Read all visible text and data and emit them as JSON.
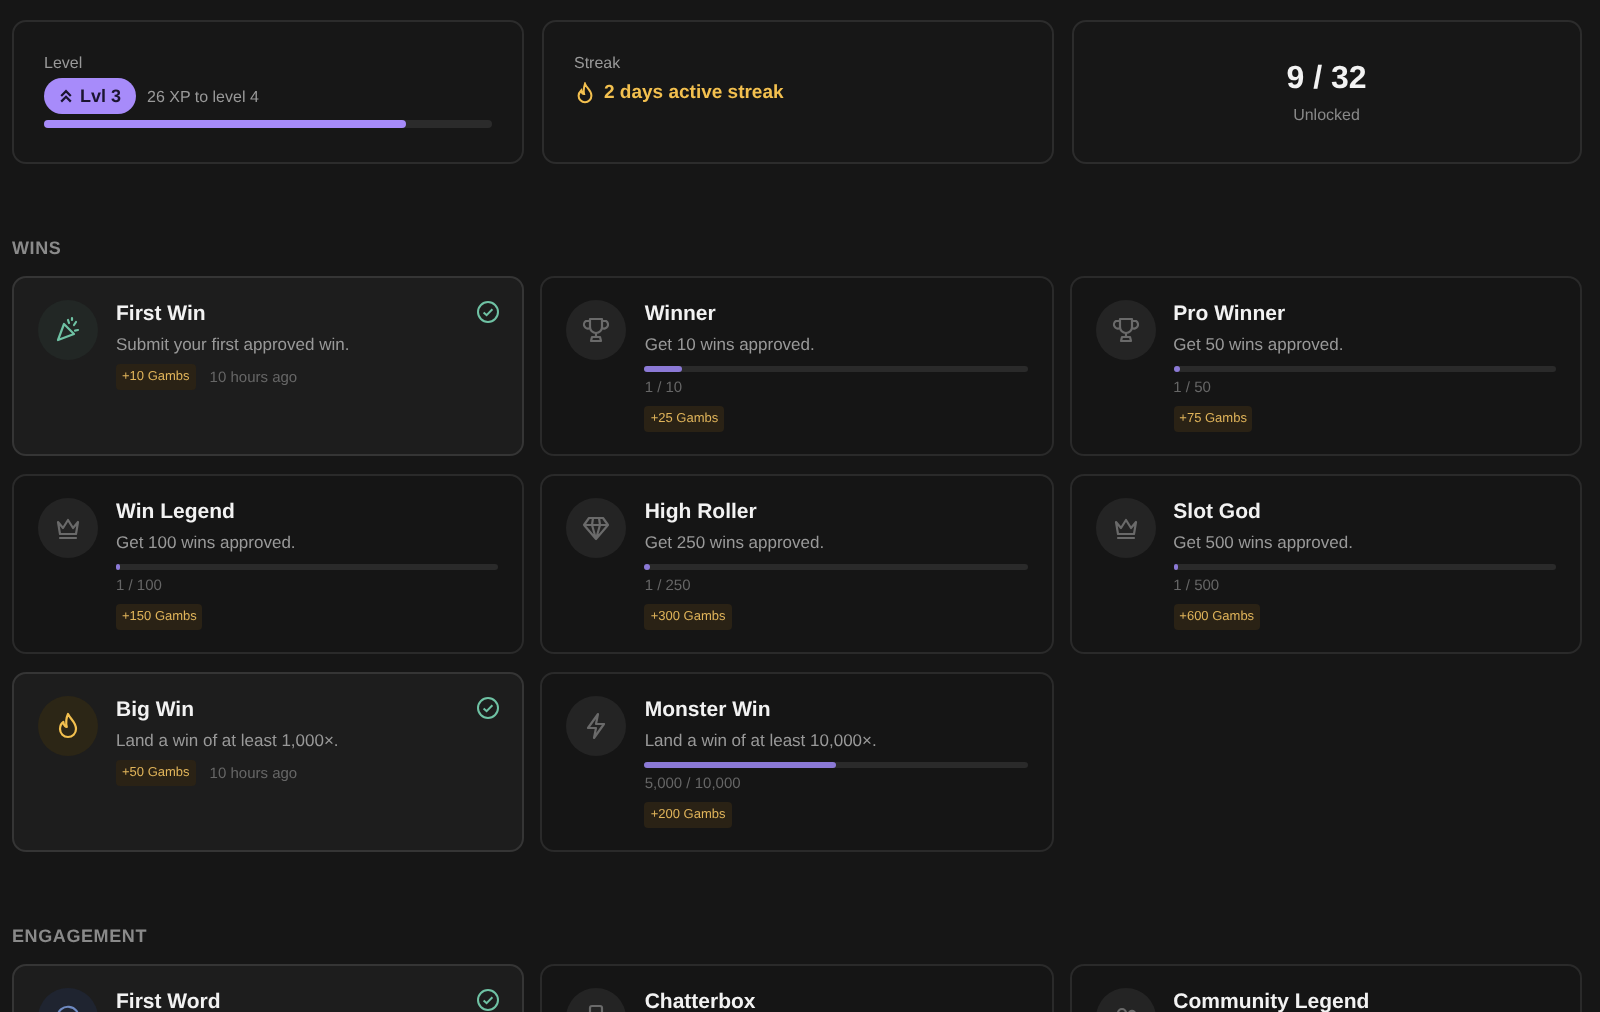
{
  "stats": {
    "level": {
      "label": "Level",
      "badge": "Lvl 3",
      "xp_text": "26 XP to level 4",
      "level": 0.81
    },
    "streak": {
      "label": "Streak",
      "text": "2 days active streak"
    },
    "unlocked": {
      "value": "9 / 32",
      "label": "Unlocked"
    }
  },
  "sections": [
    {
      "title": "WINS",
      "items": [
        {
          "title": "First Win",
          "description": "Submit your first approved win.",
          "reward": "+10 Gambs",
          "unlocked": true,
          "time": "10 hours ago"
        },
        {
          "title": "Winner",
          "description": "Get 10 wins approved.",
          "reward": "+25 Gambs",
          "unlocked": false,
          "level": 0.1,
          "progress": "1 / 10"
        },
        {
          "title": "Pro Winner",
          "description": "Get 50 wins approved.",
          "reward": "+75 Gambs",
          "unlocked": false,
          "level": 0.02,
          "progress": "1 / 50"
        },
        {
          "title": "Win Legend",
          "description": "Get 100 wins approved.",
          "reward": "+150 Gambs",
          "unlocked": false,
          "level": 0.01,
          "progress": "1 / 100"
        },
        {
          "title": "High Roller",
          "description": "Get 250 wins approved.",
          "reward": "+300 Gambs",
          "unlocked": false,
          "level": 0.004,
          "progress": "1 / 250"
        },
        {
          "title": "Slot God",
          "description": "Get 500 wins approved.",
          "reward": "+600 Gambs",
          "unlocked": false,
          "level": 0.002,
          "progress": "1 / 500"
        },
        {
          "title": "Big Win",
          "description": "Land a win of at least 1,000×.",
          "reward": "+50 Gambs",
          "unlocked": true,
          "time": "10 hours ago"
        },
        {
          "title": "Monster Win",
          "description": "Land a win of at least 10,000×.",
          "reward": "+200 Gambs",
          "unlocked": false,
          "level": 0.5,
          "progress": "5,000 / 10,000"
        }
      ]
    },
    {
      "title": "ENGAGEMENT",
      "items": [
        {
          "title": "First Word",
          "unlocked": true
        },
        {
          "title": "Chatterbox",
          "unlocked": false
        },
        {
          "title": "Community Legend",
          "unlocked": false
        }
      ]
    }
  ]
}
